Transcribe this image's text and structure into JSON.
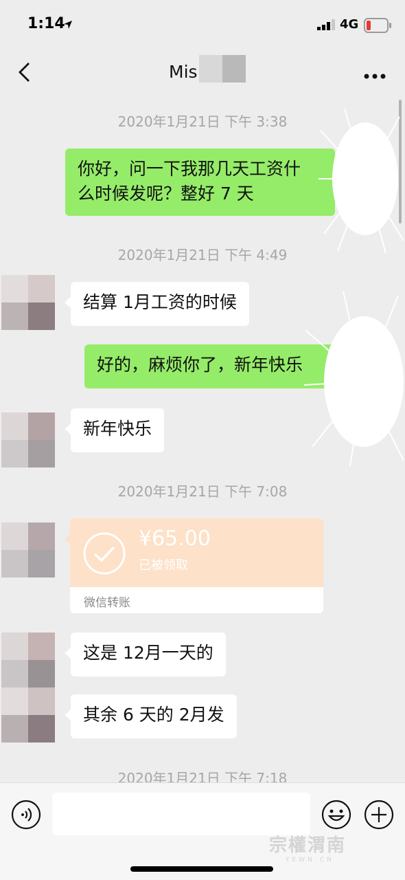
{
  "status_bar": {
    "time": "1:14",
    "network": "4G"
  },
  "header": {
    "title": "Mis"
  },
  "timestamps": [
    "2020年1月21日 下午 3:38",
    "2020年1月21日 下午 4:49",
    "2020年1月21日 下午 7:08",
    "2020年1月21日 下午 7:18"
  ],
  "messages": [
    {
      "side": "sent",
      "lines": [
        "你好，问一下我那几天工资什",
        "么时候发呢？整好 7 天"
      ]
    },
    {
      "side": "received",
      "text": "结算 1月工资的时候"
    },
    {
      "side": "sent",
      "text": "好的，麻烦你了，新年快乐"
    },
    {
      "side": "received",
      "text": "新年快乐"
    },
    {
      "side": "received",
      "text": "这是 12月一天的"
    },
    {
      "side": "received",
      "text": "其余 6 天的 2月发"
    }
  ],
  "transfer": {
    "amount": "¥65.00",
    "status": "已被领取",
    "footer": "微信转账"
  },
  "watermark": {
    "main": "宗權渭南",
    "sub": "YEWN.CN"
  },
  "colors": {
    "sent_bubble": "#95ec69",
    "received_bubble": "#ffffff",
    "transfer_card": "#fde1c8",
    "background": "#ededed"
  },
  "icons": [
    "location-arrow-icon",
    "signal-icon",
    "battery-icon",
    "back-icon",
    "more-icon",
    "voice-icon",
    "emoji-icon",
    "plus-icon",
    "check-icon"
  ]
}
